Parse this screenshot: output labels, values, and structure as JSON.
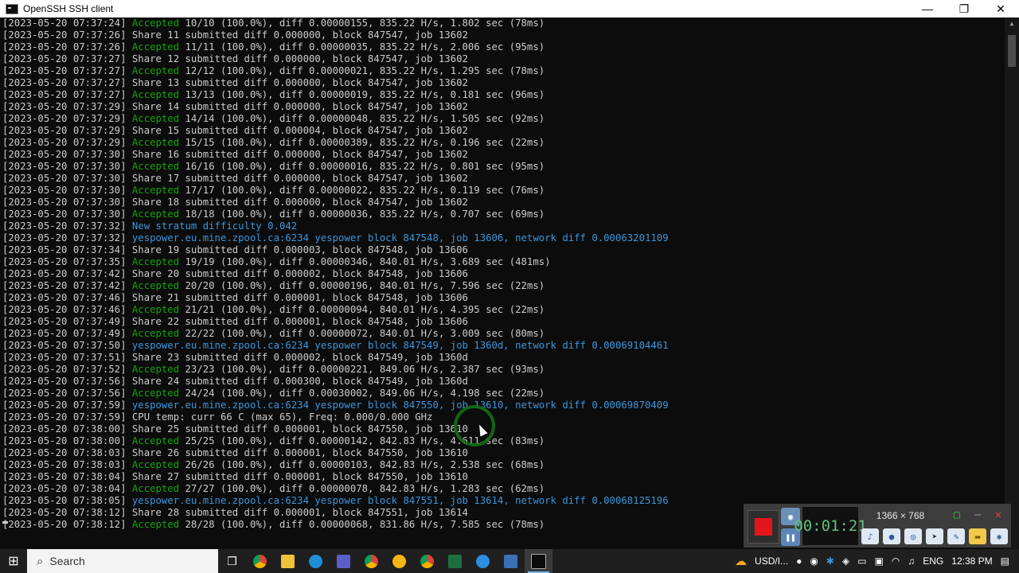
{
  "window": {
    "title": "OpenSSH SSH client",
    "minimize": "—",
    "maximize": "❐",
    "close": "✕"
  },
  "terminal": {
    "lines": [
      {
        "ts": "[2023-05-20 07:37:24]",
        "kind": "accepted",
        "pre": "Accepted",
        "text": " 10/10 (100.0%), diff 0.00000155, 835.22 H/s, 1.802 sec (78ms)"
      },
      {
        "ts": "[2023-05-20 07:37:26]",
        "kind": "plain",
        "pre": "",
        "text": "Share 11 submitted diff 0.000000, block 847547, job 13602"
      },
      {
        "ts": "[2023-05-20 07:37:26]",
        "kind": "accepted",
        "pre": "Accepted",
        "text": " 11/11 (100.0%), diff 0.00000035, 835.22 H/s, 2.006 sec (95ms)"
      },
      {
        "ts": "[2023-05-20 07:37:27]",
        "kind": "plain",
        "pre": "",
        "text": "Share 12 submitted diff 0.000000, block 847547, job 13602"
      },
      {
        "ts": "[2023-05-20 07:37:27]",
        "kind": "accepted",
        "pre": "Accepted",
        "text": " 12/12 (100.0%), diff 0.00000021, 835.22 H/s, 1.295 sec (78ms)"
      },
      {
        "ts": "[2023-05-20 07:37:27]",
        "kind": "plain",
        "pre": "",
        "text": "Share 13 submitted diff 0.000000, block 847547, job 13602"
      },
      {
        "ts": "[2023-05-20 07:37:27]",
        "kind": "accepted",
        "pre": "Accepted",
        "text": " 13/13 (100.0%), diff 0.00000019, 835.22 H/s, 0.181 sec (96ms)"
      },
      {
        "ts": "[2023-05-20 07:37:29]",
        "kind": "plain",
        "pre": "",
        "text": "Share 14 submitted diff 0.000000, block 847547, job 13602"
      },
      {
        "ts": "[2023-05-20 07:37:29]",
        "kind": "accepted",
        "pre": "Accepted",
        "text": " 14/14 (100.0%), diff 0.00000048, 835.22 H/s, 1.505 sec (92ms)"
      },
      {
        "ts": "[2023-05-20 07:37:29]",
        "kind": "plain",
        "pre": "",
        "text": "Share 15 submitted diff 0.000004, block 847547, job 13602"
      },
      {
        "ts": "[2023-05-20 07:37:29]",
        "kind": "accepted",
        "pre": "Accepted",
        "text": " 15/15 (100.0%), diff 0.00000389, 835.22 H/s, 0.196 sec (22ms)"
      },
      {
        "ts": "[2023-05-20 07:37:30]",
        "kind": "plain",
        "pre": "",
        "text": "Share 16 submitted diff 0.000000, block 847547, job 13602"
      },
      {
        "ts": "[2023-05-20 07:37:30]",
        "kind": "accepted",
        "pre": "Accepted",
        "text": " 16/16 (100.0%), diff 0.00000016, 835.22 H/s, 0.801 sec (95ms)"
      },
      {
        "ts": "[2023-05-20 07:37:30]",
        "kind": "plain",
        "pre": "",
        "text": "Share 17 submitted diff 0.000000, block 847547, job 13602"
      },
      {
        "ts": "[2023-05-20 07:37:30]",
        "kind": "accepted",
        "pre": "Accepted",
        "text": " 17/17 (100.0%), diff 0.00000022, 835.22 H/s, 0.119 sec (76ms)"
      },
      {
        "ts": "[2023-05-20 07:37:30]",
        "kind": "plain",
        "pre": "",
        "text": "Share 18 submitted diff 0.000000, block 847547, job 13602"
      },
      {
        "ts": "[2023-05-20 07:37:30]",
        "kind": "accepted",
        "pre": "Accepted",
        "text": " 18/18 (100.0%), diff 0.00000036, 835.22 H/s, 0.707 sec (69ms)"
      },
      {
        "ts": "[2023-05-20 07:37:32]",
        "kind": "blue",
        "pre": "",
        "text": "New stratum difficulty 0.042"
      },
      {
        "ts": "[2023-05-20 07:37:32]",
        "kind": "blue",
        "pre": "",
        "text": "yespower.eu.mine.zpool.ca:6234 yespower block 847548, job 13606, network diff 0.00063201109"
      },
      {
        "ts": "[2023-05-20 07:37:34]",
        "kind": "plain",
        "pre": "",
        "text": "Share 19 submitted diff 0.000003, block 847548, job 13606"
      },
      {
        "ts": "[2023-05-20 07:37:35]",
        "kind": "accepted",
        "pre": "Accepted",
        "text": " 19/19 (100.0%), diff 0.00000346, 840.01 H/s, 3.689 sec (481ms)"
      },
      {
        "ts": "[2023-05-20 07:37:42]",
        "kind": "plain",
        "pre": "",
        "text": "Share 20 submitted diff 0.000002, block 847548, job 13606"
      },
      {
        "ts": "[2023-05-20 07:37:42]",
        "kind": "accepted",
        "pre": "Accepted",
        "text": " 20/20 (100.0%), diff 0.00000196, 840.01 H/s, 7.596 sec (22ms)"
      },
      {
        "ts": "[2023-05-20 07:37:46]",
        "kind": "plain",
        "pre": "",
        "text": "Share 21 submitted diff 0.000001, block 847548, job 13606"
      },
      {
        "ts": "[2023-05-20 07:37:46]",
        "kind": "accepted",
        "pre": "Accepted",
        "text": " 21/21 (100.0%), diff 0.00000094, 840.01 H/s, 4.395 sec (22ms)"
      },
      {
        "ts": "[2023-05-20 07:37:49]",
        "kind": "plain",
        "pre": "",
        "text": "Share 22 submitted diff 0.000001, block 847548, job 13606"
      },
      {
        "ts": "[2023-05-20 07:37:49]",
        "kind": "accepted",
        "pre": "Accepted",
        "text": " 22/22 (100.0%), diff 0.00000072, 840.01 H/s, 3.009 sec (80ms)"
      },
      {
        "ts": "[2023-05-20 07:37:50]",
        "kind": "blue",
        "pre": "",
        "text": "yespower.eu.mine.zpool.ca:6234 yespower block 847549, job 1360d, network diff 0.00069104461"
      },
      {
        "ts": "[2023-05-20 07:37:51]",
        "kind": "plain",
        "pre": "",
        "text": "Share 23 submitted diff 0.000002, block 847549, job 1360d"
      },
      {
        "ts": "[2023-05-20 07:37:52]",
        "kind": "accepted",
        "pre": "Accepted",
        "text": " 23/23 (100.0%), diff 0.00000221, 849.06 H/s, 2.387 sec (93ms)"
      },
      {
        "ts": "[2023-05-20 07:37:56]",
        "kind": "plain",
        "pre": "",
        "text": "Share 24 submitted diff 0.000300, block 847549, job 1360d"
      },
      {
        "ts": "[2023-05-20 07:37:56]",
        "kind": "accepted",
        "pre": "Accepted",
        "text": " 24/24 (100.0%), diff 0.00030002, 849.06 H/s, 4.198 sec (22ms)"
      },
      {
        "ts": "[2023-05-20 07:37:59]",
        "kind": "blue",
        "pre": "",
        "text": "yespower.eu.mine.zpool.ca:6234 yespower block 847550, job 13610, network diff 0.00069870409"
      },
      {
        "ts": "[2023-05-20 07:37:59]",
        "kind": "plain",
        "pre": "",
        "text": "CPU temp: curr 66 C (max 65), Freq: 0.000/0.000 GHz"
      },
      {
        "ts": "[2023-05-20 07:38:00]",
        "kind": "plain",
        "pre": "",
        "text": "Share 25 submitted diff 0.000001, block 847550, job 13610"
      },
      {
        "ts": "[2023-05-20 07:38:00]",
        "kind": "accepted",
        "pre": "Accepted",
        "text": " 25/25 (100.0%), diff 0.00000142, 842.83 H/s, 4.611 sec (83ms)"
      },
      {
        "ts": "[2023-05-20 07:38:03]",
        "kind": "plain",
        "pre": "",
        "text": "Share 26 submitted diff 0.000001, block 847550, job 13610"
      },
      {
        "ts": "[2023-05-20 07:38:03]",
        "kind": "accepted",
        "pre": "Accepted",
        "text": " 26/26 (100.0%), diff 0.00000103, 842.83 H/s, 2.538 sec (68ms)"
      },
      {
        "ts": "[2023-05-20 07:38:04]",
        "kind": "plain",
        "pre": "",
        "text": "Share 27 submitted diff 0.000001, block 847550, job 13610"
      },
      {
        "ts": "[2023-05-20 07:38:04]",
        "kind": "accepted",
        "pre": "Accepted",
        "text": " 27/27 (100.0%), diff 0.00000078, 842.83 H/s, 1.283 sec (62ms)"
      },
      {
        "ts": "[2023-05-20 07:38:05]",
        "kind": "blue",
        "pre": "",
        "text": "yespower.eu.mine.zpool.ca:6234 yespower block 847551, job 13614, network diff 0.00068125196"
      },
      {
        "ts": "[2023-05-20 07:38:12]",
        "kind": "plain",
        "pre": "",
        "text": "Share 28 submitted diff 0.000001, block 847551, job 13614"
      },
      {
        "ts": "[2023-05-20 07:38:12]",
        "kind": "accepted",
        "pre": "Accepted",
        "text": " 28/28 (100.0%), diff 0.00000068, 831.86 H/s, 7.585 sec (78ms)"
      }
    ]
  },
  "recorder": {
    "timer": "00:01:21",
    "resolution": "1366 × 768"
  },
  "taskbar": {
    "search_placeholder": "Search",
    "weather": "USD/I...",
    "language": "ENG",
    "time": "12:38 PM"
  },
  "colors": {
    "accepted": "#13a10e",
    "info_blue": "#3a96dd",
    "terminal_bg": "#0c0c0c",
    "terminal_fg": "#cccccc"
  }
}
